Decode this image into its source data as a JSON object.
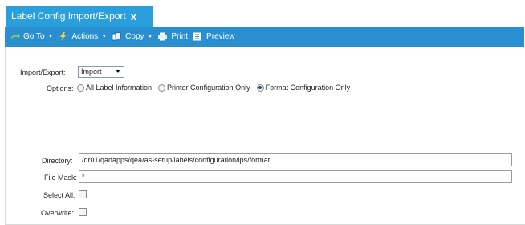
{
  "tab": {
    "title": "Label Config Import/Export",
    "close": "x"
  },
  "toolbar": {
    "goto_label": "Go To",
    "actions_label": "Actions",
    "copy_label": "Copy",
    "print_label": "Print",
    "preview_label": "Preview",
    "caret": "▼"
  },
  "form": {
    "import_export_label": "Import/Export:",
    "import_export_value": "Import",
    "options_label": "Options:",
    "options": [
      {
        "label": "All Label Information",
        "checked": false
      },
      {
        "label": "Printer Configuration Only",
        "checked": false
      },
      {
        "label": "Format Configuration Only",
        "checked": true
      }
    ],
    "directory_label": "Directory:",
    "directory_value": "/dr01/qadapps/qea/as-setup/labels/configuration/lps/format",
    "file_mask_label": "File Mask:",
    "file_mask_value": "*",
    "select_all_label": "Select All:",
    "overwrite_label": "Overwrite:"
  },
  "colors": {
    "tab_bg": "#2b9fdb",
    "toolbar_bg": "#2a8fd0",
    "goto_icon": "#7fd04a",
    "actions_icon": "#ffd23a"
  }
}
